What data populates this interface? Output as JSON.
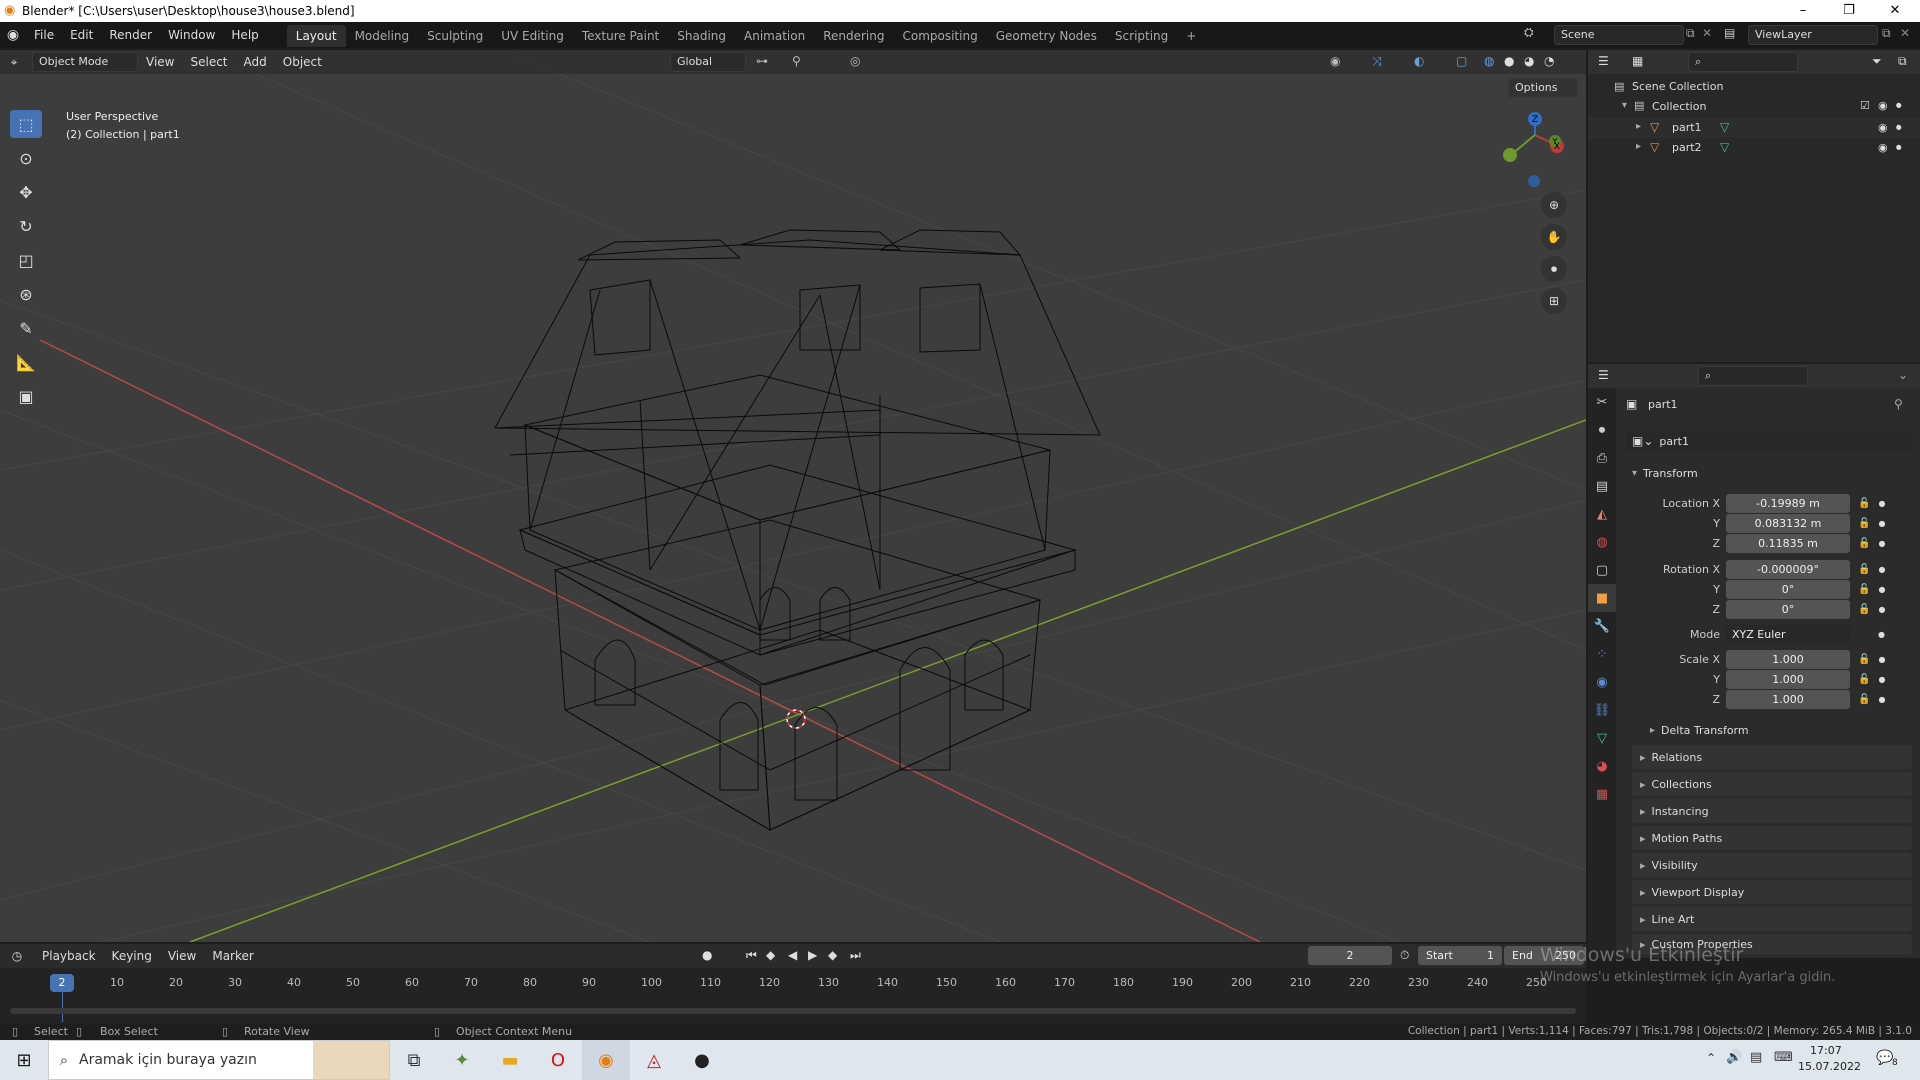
{
  "window": {
    "title": "Blender* [C:\\Users\\user\\Desktop\\house3\\house3.blend]"
  },
  "menus": [
    "File",
    "Edit",
    "Render",
    "Window",
    "Help"
  ],
  "workspaces": [
    "Layout",
    "Modeling",
    "Sculpting",
    "UV Editing",
    "Texture Paint",
    "Shading",
    "Animation",
    "Rendering",
    "Compositing",
    "Geometry Nodes",
    "Scripting"
  ],
  "scene": {
    "scene_name": "Scene",
    "view_layer": "ViewLayer"
  },
  "viewport_header": {
    "mode": "Object Mode",
    "menus": [
      "View",
      "Select",
      "Add",
      "Object"
    ],
    "orientation": "Global",
    "options": "Options"
  },
  "viewport_info": {
    "perspective": "User Perspective",
    "collection": "(2) Collection | part1"
  },
  "gizmo": {
    "x": "X",
    "y": "Y",
    "z": "Z"
  },
  "outliner": {
    "root": "Scene Collection",
    "collection": "Collection",
    "items": [
      "part1",
      "part2"
    ]
  },
  "properties": {
    "object_name": "part1",
    "data_name": "part1",
    "transform_label": "Transform",
    "location_label": "Location X",
    "rotation_label": "Rotation X",
    "scale_label": "Scale X",
    "mode_label": "Mode",
    "y": "Y",
    "z": "Z",
    "location": [
      "-0.19989 m",
      "0.083132 m",
      "0.11835 m"
    ],
    "rotation": [
      "-0.000009°",
      "0°",
      "0°"
    ],
    "mode": "XYZ Euler",
    "scale": [
      "1.000",
      "1.000",
      "1.000"
    ],
    "delta": "Delta Transform",
    "sections": [
      "Relations",
      "Collections",
      "Instancing",
      "Motion Paths",
      "Visibility",
      "Viewport Display",
      "Line Art",
      "Custom Properties"
    ]
  },
  "timeline": {
    "menus": [
      "Playback",
      "Keying",
      "View",
      "Marker"
    ],
    "current_frame": "2",
    "start_label": "Start",
    "start": "1",
    "end_label": "End",
    "end": "250",
    "ticks": [
      "10",
      "20",
      "30",
      "40",
      "50",
      "60",
      "70",
      "80",
      "90",
      "100",
      "110",
      "120",
      "130",
      "140",
      "150",
      "160",
      "170",
      "180",
      "190",
      "200",
      "210",
      "220",
      "230",
      "240",
      "250"
    ]
  },
  "watermark": {
    "line1": "Windows'u Etkinleştir",
    "line2": "Windows'u etkinleştirmek için Ayarlar'a gidin."
  },
  "statusbar": {
    "select": "Select",
    "box_select": "Box Select",
    "rotate": "Rotate View",
    "context": "Object Context Menu",
    "stats": "Collection | part1 | Verts:1,114 | Faces:797 | Tris:1,798 | Objects:0/2 | Memory: 265.4 MiB | 3.1.0"
  },
  "taskbar": {
    "search": "Aramak için buraya yazın",
    "time": "17:07",
    "date": "15.07.2022",
    "notifications": "8"
  }
}
